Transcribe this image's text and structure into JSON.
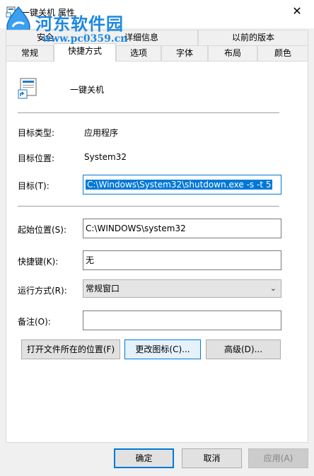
{
  "window": {
    "title": "一键关机 属性",
    "close": "✕"
  },
  "watermark": {
    "site": "河东软件园",
    "url": "www.pc0359.cn"
  },
  "tabs_back": [
    "安全",
    "详细信息",
    "以前的版本"
  ],
  "tabs_front": [
    "常规",
    "快捷方式",
    "选项",
    "字体",
    "布局",
    "颜色"
  ],
  "active_tab": "快捷方式",
  "shortcut": {
    "name": "一键关机",
    "target_type_label": "目标类型:",
    "target_type": "应用程序",
    "target_location_label": "目标位置:",
    "target_location": "System32",
    "target_label": "目标(T):",
    "target": "C:\\Windows\\System32\\shutdown.exe -s -t 5",
    "start_in_label": "起始位置(S):",
    "start_in": "C:\\WINDOWS\\system32",
    "hotkey_label": "快捷键(K):",
    "hotkey": "无",
    "run_label": "运行方式(R):",
    "run": "常规窗口",
    "comment_label": "备注(O):",
    "comment": ""
  },
  "panel_buttons": {
    "open_location": "打开文件所在的位置(F)",
    "change_icon": "更改图标(C)...",
    "advanced": "高级(D)..."
  },
  "dialog_buttons": {
    "ok": "确定",
    "cancel": "取消",
    "apply": "应用(A)"
  }
}
